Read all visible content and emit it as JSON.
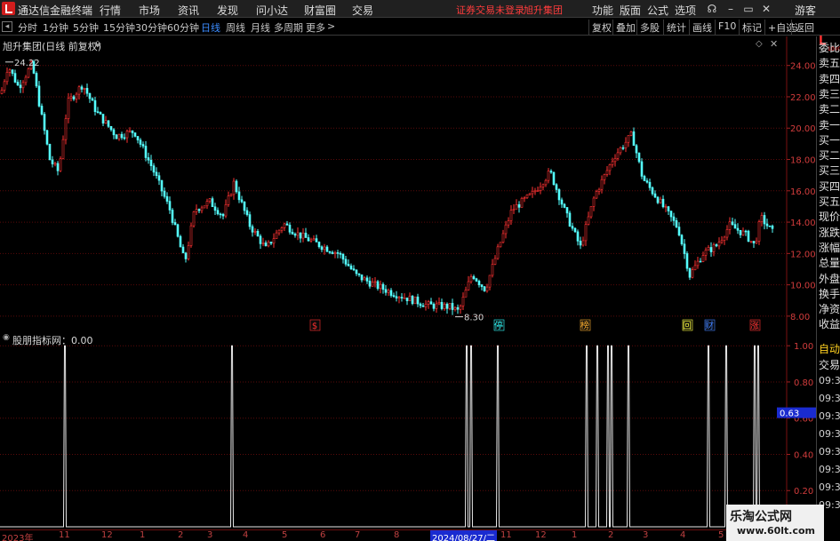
{
  "app": {
    "title": "通达信金融终端",
    "menus": [
      "行情",
      "市场",
      "资讯",
      "发现",
      "问小达",
      "财富圈",
      "交易"
    ],
    "notice": "证券交易未登录",
    "notice_stock": "旭升集团",
    "right_menus": [
      "功能",
      "版面",
      "公式",
      "选项"
    ],
    "guest": "游客"
  },
  "toolbar": {
    "periods": [
      "分时",
      "1分钟",
      "5分钟",
      "15分钟",
      "30分钟",
      "60分钟",
      "日线",
      "周线",
      "月线",
      "多周期",
      "更多"
    ],
    "active_period": "日线",
    "more_arrow": ">",
    "buttons": [
      "复权",
      "叠加",
      "多股",
      "统计",
      "画线",
      "F10",
      "标记",
      "+自选",
      "返回"
    ]
  },
  "main_chart": {
    "stock_title": "旭升集团(日线 前复权)",
    "high_label": "24.22",
    "low_label": "8.30",
    "ylim": [
      7.2,
      25.4
    ],
    "y_ticks": [
      "24.00",
      "22.00",
      "20.00",
      "18.00",
      "16.00",
      "14.00",
      "12.00",
      "10.00",
      "8.00"
    ],
    "markers": [
      {
        "label": "$",
        "color": "#ff3030"
      },
      {
        "label": "停",
        "color": "#30ffff"
      },
      {
        "label": "榜",
        "color": "#ffb030"
      },
      {
        "label": "回",
        "color": "#ffff40"
      },
      {
        "label": "财",
        "color": "#4080ff"
      },
      {
        "label": "涨",
        "color": "#ff3030"
      }
    ]
  },
  "indicator": {
    "title": "股朋指标网：0.00",
    "ylim": [
      0,
      1.05
    ],
    "y_ticks": [
      "1.00",
      "0.80",
      "0.60",
      "0.40",
      "0.20"
    ],
    "cursor_value": "0.63"
  },
  "right_panel": {
    "corner": "L",
    "corner_sub": "1000",
    "items": [
      "委比",
      "卖五",
      "卖四",
      "卖三",
      "卖二",
      "卖一",
      "买一",
      "买二",
      "买三",
      "买四",
      "买五",
      "现价",
      "涨跌",
      "涨幅",
      "总量",
      "外盘",
      "换手",
      "净资",
      "收益"
    ],
    "auto_label": "自动",
    "trade_label": "交易",
    "times": [
      "09:36",
      "09:36",
      "09:36",
      "09:36",
      "09:36",
      "09:36",
      "09:36",
      "09:36"
    ]
  },
  "date_axis": [
    "2023年",
    "11",
    "12",
    "1",
    "2",
    "3",
    "4",
    "5",
    "6",
    "7",
    "8",
    "2024/08/27/二",
    "11",
    "12",
    "1",
    "2",
    "3",
    "4",
    "5"
  ],
  "watermark": {
    "main": "乐淘公式网",
    "sub": "www.60lt.com"
  },
  "colors": {
    "up": "#ff3232",
    "down": "#54ffff",
    "grid": "#5a0a0a",
    "axis_text": "#d23c3c",
    "indicator_line": "#e8e8e8"
  }
}
